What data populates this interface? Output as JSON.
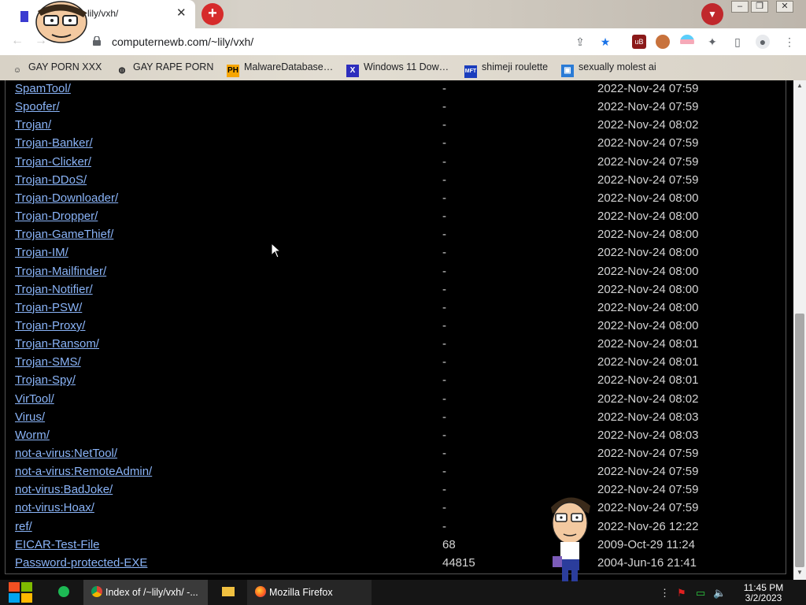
{
  "browser": {
    "tab_title": "~lily/vxh/",
    "url": "computernewb.com/~lily/vxh/",
    "bookmarks": [
      {
        "label": "GAY PORN XXX",
        "icon": "globe-smile-icon"
      },
      {
        "label": "GAY RAPE PORN",
        "icon": "globe-icon"
      },
      {
        "label": "MalwareDatabase…",
        "icon": "PH"
      },
      {
        "label": "Windows 11 Dow…",
        "icon": "X"
      },
      {
        "label": "shimeji roulette",
        "icon": "MFT"
      },
      {
        "label": "sexually molest ai",
        "icon": "image-icon"
      }
    ]
  },
  "listing": {
    "rows": [
      {
        "name": "SpamTool/",
        "size": "-",
        "date": "2022-Nov-24 07:59"
      },
      {
        "name": "Spoofer/",
        "size": "-",
        "date": "2022-Nov-24 07:59"
      },
      {
        "name": "Trojan/",
        "size": "-",
        "date": "2022-Nov-24 08:02"
      },
      {
        "name": "Trojan-Banker/",
        "size": "-",
        "date": "2022-Nov-24 07:59"
      },
      {
        "name": "Trojan-Clicker/",
        "size": "-",
        "date": "2022-Nov-24 07:59"
      },
      {
        "name": "Trojan-DDoS/",
        "size": "-",
        "date": "2022-Nov-24 07:59"
      },
      {
        "name": "Trojan-Downloader/",
        "size": "-",
        "date": "2022-Nov-24 08:00"
      },
      {
        "name": "Trojan-Dropper/",
        "size": "-",
        "date": "2022-Nov-24 08:00"
      },
      {
        "name": "Trojan-GameThief/",
        "size": "-",
        "date": "2022-Nov-24 08:00"
      },
      {
        "name": "Trojan-IM/",
        "size": "-",
        "date": "2022-Nov-24 08:00"
      },
      {
        "name": "Trojan-Mailfinder/",
        "size": "-",
        "date": "2022-Nov-24 08:00"
      },
      {
        "name": "Trojan-Notifier/",
        "size": "-",
        "date": "2022-Nov-24 08:00"
      },
      {
        "name": "Trojan-PSW/",
        "size": "-",
        "date": "2022-Nov-24 08:00"
      },
      {
        "name": "Trojan-Proxy/",
        "size": "-",
        "date": "2022-Nov-24 08:00"
      },
      {
        "name": "Trojan-Ransom/",
        "size": "-",
        "date": "2022-Nov-24 08:01"
      },
      {
        "name": "Trojan-SMS/",
        "size": "-",
        "date": "2022-Nov-24 08:01"
      },
      {
        "name": "Trojan-Spy/",
        "size": "-",
        "date": "2022-Nov-24 08:01"
      },
      {
        "name": "VirTool/",
        "size": "-",
        "date": "2022-Nov-24 08:02"
      },
      {
        "name": "Virus/",
        "size": "-",
        "date": "2022-Nov-24 08:03"
      },
      {
        "name": "Worm/",
        "size": "-",
        "date": "2022-Nov-24 08:03"
      },
      {
        "name": "not-a-virus:NetTool/",
        "size": "-",
        "date": "2022-Nov-24 07:59"
      },
      {
        "name": "not-a-virus:RemoteAdmin/",
        "size": "-",
        "date": "2022-Nov-24 07:59"
      },
      {
        "name": "not-virus:BadJoke/",
        "size": "-",
        "date": "2022-Nov-24 07:59"
      },
      {
        "name": "not-virus:Hoax/",
        "size": "-",
        "date": "2022-Nov-24 07:59"
      },
      {
        "name": "ref/",
        "size": "-",
        "date": "2022-Nov-26 12:22"
      },
      {
        "name": "EICAR-Test-File",
        "size": "68",
        "date": "2009-Oct-29 11:24"
      },
      {
        "name": "Password-protected-EXE",
        "size": "44815",
        "date": "2004-Jun-16 21:41"
      }
    ]
  },
  "taskbar": {
    "chrome_label": "Index of /~lily/vxh/ -...",
    "firefox_label": "Mozilla Firefox",
    "time": "11:45 PM",
    "date": "3/2/2023"
  },
  "colors": {
    "link": "#8ab4f8",
    "page_bg": "#000000",
    "accent_red": "#d62b2b"
  }
}
